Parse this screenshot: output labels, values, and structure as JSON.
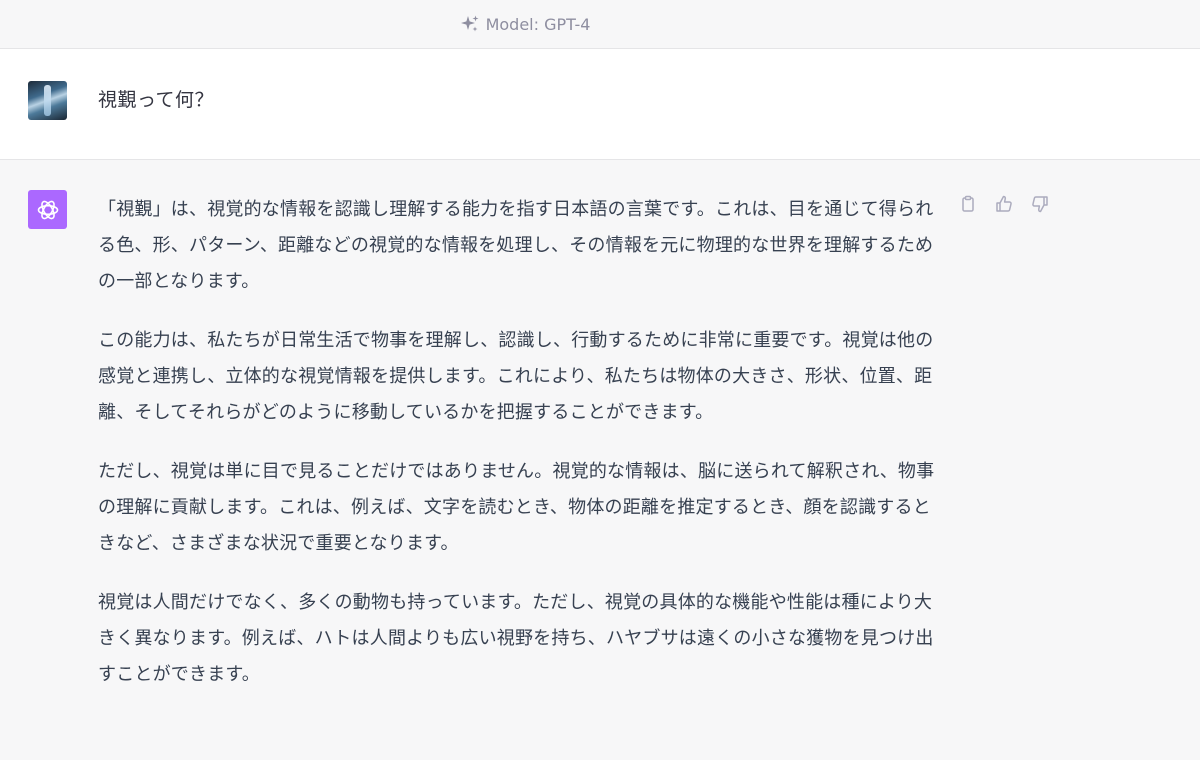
{
  "header": {
    "model_label": "Model: GPT-4",
    "icon": "sparkles-icon"
  },
  "user_message": {
    "avatar": "user-avatar",
    "text": "視覲って何？"
  },
  "assistant_message": {
    "avatar": "openai-logo-icon",
    "avatar_color": "#ab68ff",
    "paragraphs": [
      "「視覲」は、視覚的な情報を認識し理解する能力を指す日本語の言葉です。これは、目を通じて得られる色、形、パターン、距離などの視覚的な情報を処理し、その情報を元に物理的な世界を理解するための一部となります。",
      "この能力は、私たちが日常生活で物事を理解し、認識し、行動するために非常に重要です。視覚は他の感覚と連携し、立体的な視覚情報を提供します。これにより、私たちは物体の大きさ、形状、位置、距離、そしてそれらがどのように移動しているかを把握することができます。",
      "ただし、視覚は単に目で見ることだけではありません。視覚的な情報は、脳に送られて解釈され、物事の理解に貢献します。これは、例えば、文字を読むとき、物体の距離を推定するとき、顔を認識するときなど、さまざまな状況で重要となります。",
      "視覚は人間だけでなく、多くの動物も持っています。ただし、視覚の具体的な機能や性能は種により大きく異なります。例えば、ハトは人間よりも広い視野を持ち、ハヤブサは遠くの小さな獲物を見つけ出すことができます。"
    ],
    "actions": [
      "clipboard-icon",
      "thumbs-up-icon",
      "thumbs-down-icon"
    ]
  }
}
